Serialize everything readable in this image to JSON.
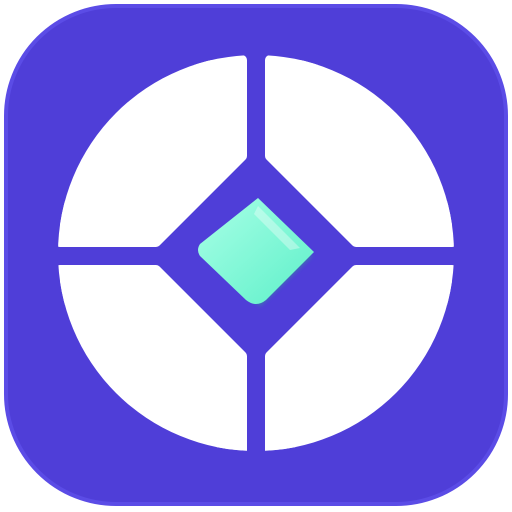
{
  "icon": {
    "name": "app-logo-icon",
    "description_free": true,
    "colors": {
      "tile": "#4F3ED8",
      "tile_edge": "#5B4CE6",
      "segments": "#FFFFFF",
      "gem": "#5EF0C9",
      "gem_shadow": "#2FA889",
      "gem_highlight": "#A8FFE6"
    }
  }
}
